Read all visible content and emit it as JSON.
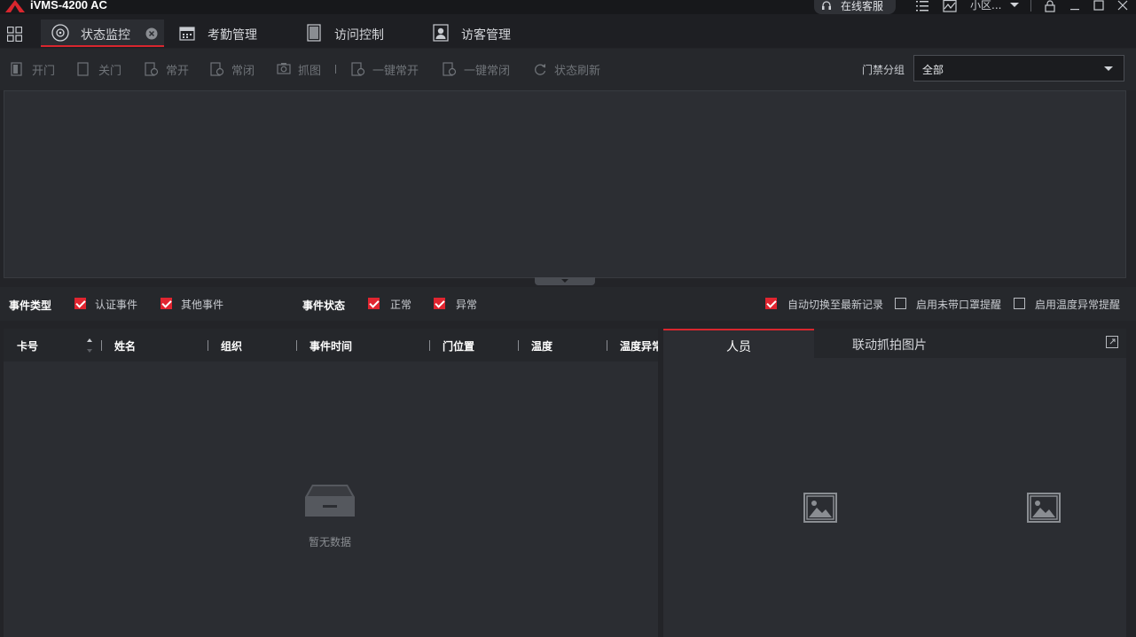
{
  "window": {
    "title": "iVMS-4200 AC",
    "online_service": "在线客服",
    "user": "小区..."
  },
  "tabs": [
    {
      "label": "状态监控",
      "active": true
    },
    {
      "label": "考勤管理",
      "active": false
    },
    {
      "label": "访问控制",
      "active": false
    },
    {
      "label": "访客管理",
      "active": false
    }
  ],
  "toolbar": {
    "open_door": "开门",
    "close_door": "关门",
    "stay_open": "常开",
    "stay_closed": "常闭",
    "capture": "抓图",
    "all_open": "一键常开",
    "all_closed": "一键常闭",
    "refresh": "状态刷新",
    "group_label": "门禁分组",
    "group_value": "全部"
  },
  "filters": {
    "event_type_label": "事件类型",
    "auth_event": "认证事件",
    "other_event": "其他事件",
    "event_status_label": "事件状态",
    "normal": "正常",
    "abnormal": "异常",
    "auto_switch": "自动切换至最新记录",
    "mask_alert": "启用未带口罩提醒",
    "temp_alert": "启用温度异常提醒"
  },
  "table": {
    "columns": [
      "卡号",
      "姓名",
      "组织",
      "事件时间",
      "门位置",
      "温度",
      "温度异常"
    ],
    "empty_text": "暂无数据"
  },
  "right_panel": {
    "tab_person": "人员",
    "tab_capture": "联动抓拍图片"
  },
  "colors": {
    "accent": "#d8262e",
    "background": "#232428",
    "panel": "#2b2d32"
  }
}
